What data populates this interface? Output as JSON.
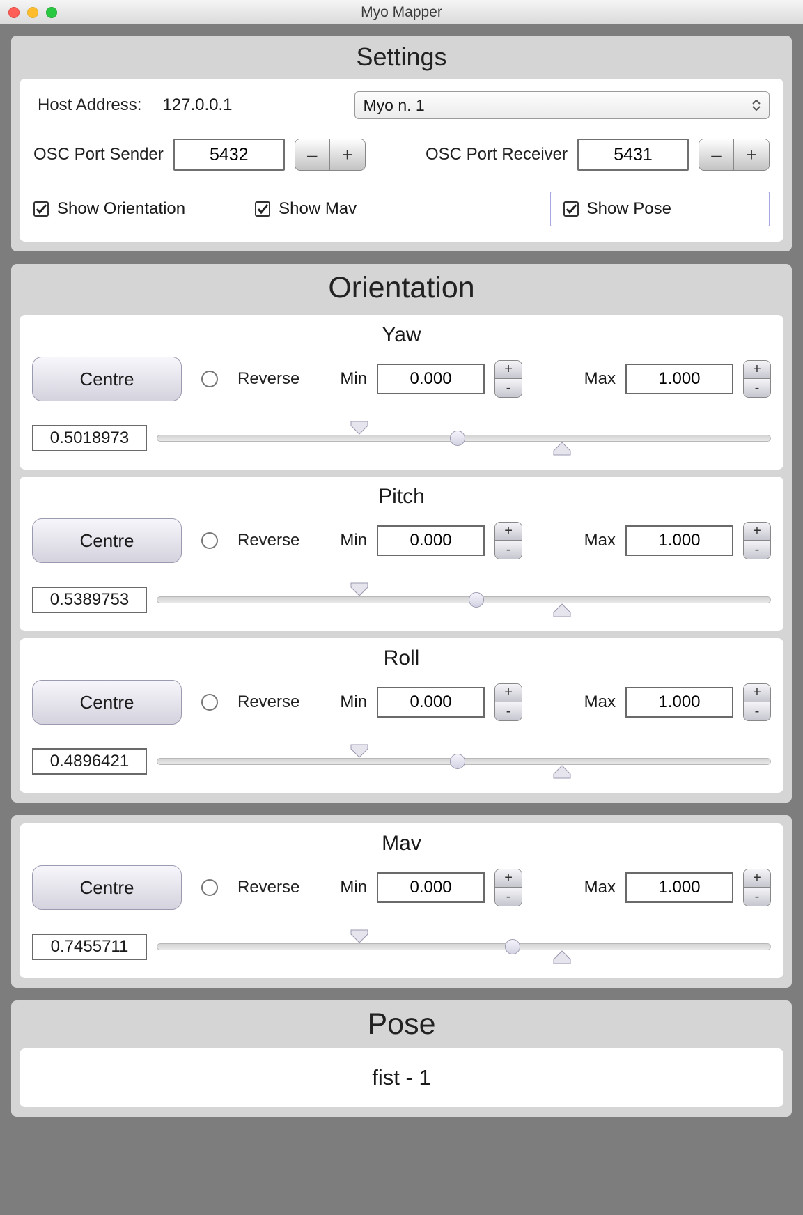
{
  "window": {
    "title": "Myo Mapper"
  },
  "settings": {
    "title": "Settings",
    "host_label": "Host Address:",
    "host_value": "127.0.0.1",
    "myo_selected": "Myo n. 1",
    "sender_label": "OSC Port Sender",
    "sender_value": "5432",
    "receiver_label": "OSC Port Receiver",
    "receiver_value": "5431",
    "minus": "–",
    "plus": "+",
    "show_orientation": "Show Orientation",
    "show_mav": "Show Mav",
    "show_pose": "Show Pose"
  },
  "orientation": {
    "title": "Orientation",
    "centre": "Centre",
    "reverse": "Reverse",
    "min_label": "Min",
    "max_label": "Max",
    "plus": "+",
    "minus": "-",
    "yaw": {
      "title": "Yaw",
      "min": "0.000",
      "max": "1.000",
      "value": "0.5018973",
      "thumb_pct": 49,
      "marker_low_pct": 33,
      "marker_high_pct": 66
    },
    "pitch": {
      "title": "Pitch",
      "min": "0.000",
      "max": "1.000",
      "value": "0.5389753",
      "thumb_pct": 52,
      "marker_low_pct": 33,
      "marker_high_pct": 66
    },
    "roll": {
      "title": "Roll",
      "min": "0.000",
      "max": "1.000",
      "value": "0.4896421",
      "thumb_pct": 49,
      "marker_low_pct": 33,
      "marker_high_pct": 66
    }
  },
  "mav": {
    "title": "Mav",
    "min": "0.000",
    "max": "1.000",
    "value": "0.7455711",
    "thumb_pct": 58,
    "marker_low_pct": 33,
    "marker_high_pct": 66
  },
  "pose": {
    "title": "Pose",
    "value": "fist - 1"
  }
}
